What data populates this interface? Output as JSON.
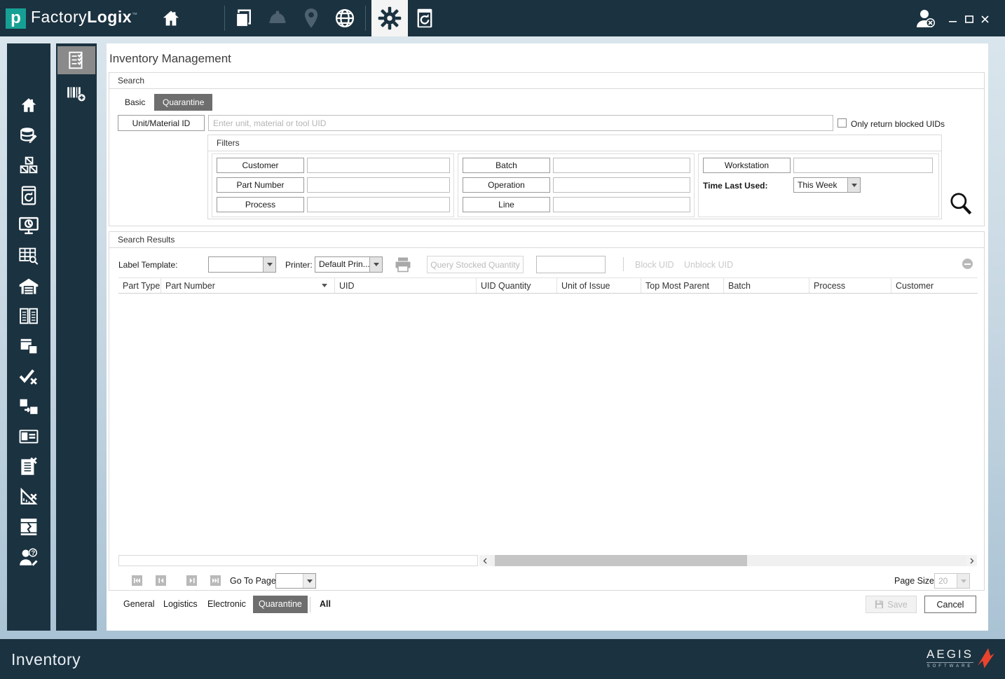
{
  "colors": {
    "navy": "#1b3240",
    "teal": "#16a095",
    "selected_tab_gray": "#6e6e6e",
    "disabled_text": "#c9c9c9",
    "aegis_orange": "#e8432e"
  },
  "titlebar": {
    "logo_letter": "p",
    "brand_primary": "Factory",
    "brand_secondary": "Logix",
    "trademark": "™"
  },
  "main": {
    "page_title": "Inventory Management",
    "search": {
      "group_label": "Search",
      "tabs": {
        "basic": "Basic",
        "quarantine": "Quarantine"
      },
      "unit_material_button": "Unit/Material ID",
      "unit_input_placeholder": "Enter unit, material or tool UID",
      "blocked_uids_checkbox": "Only return blocked UIDs",
      "filters": {
        "group_label": "Filters",
        "customer": "Customer",
        "part_number": "Part Number",
        "process": "Process",
        "batch": "Batch",
        "operation": "Operation",
        "line": "Line",
        "workstation": "Workstation",
        "time_last_used_label": "Time Last Used:",
        "time_last_used_value": "This Week"
      }
    },
    "results": {
      "group_label": "Search Results",
      "label_template_label": "Label Template:",
      "label_template_value": "",
      "printer_label": "Printer:",
      "printer_value": "Default Prin...",
      "query_stocked_quantity": "Query Stocked Quantity",
      "stocked_quantity_value": "",
      "block_uid": "Block UID",
      "unblock_uid": "Unblock UID",
      "columns": [
        "Part Type",
        "Part Number",
        "UID",
        "UID Quantity",
        "Unit of Issue",
        "Top Most Parent",
        "Batch",
        "Process",
        "Customer"
      ],
      "rows": []
    },
    "pagination": {
      "go_to_page_label": "Go To Page",
      "go_to_page_value": "",
      "page_size_label": "Page Size",
      "page_size_value": "20"
    },
    "category_tabs": {
      "general": "General",
      "logistics": "Logistics",
      "electronic": "Electronic",
      "quarantine": "Quarantine",
      "all": "All"
    },
    "save_button": "Save",
    "cancel_button": "Cancel"
  },
  "statusbar": {
    "module_title": "Inventory",
    "brand_name": "AEGIS",
    "brand_subtitle": "SOFTWARE"
  }
}
